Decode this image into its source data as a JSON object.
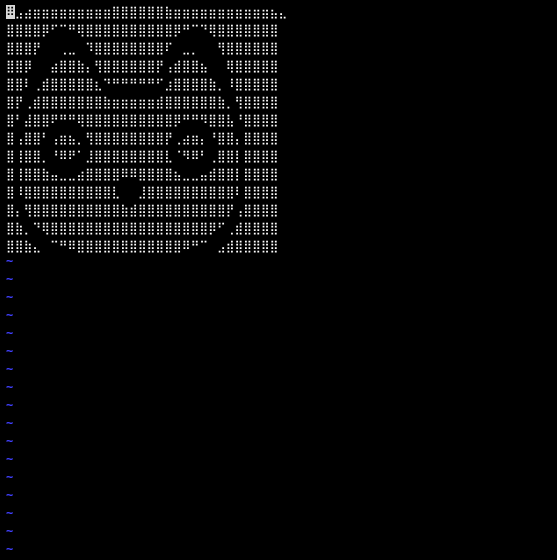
{
  "editor": {
    "cursor_char": "⠿",
    "colors": {
      "background": "#000000",
      "text": "#ffffff",
      "tilde": "#4040ff",
      "cursor": "#d8d8d8"
    },
    "lines": [
      "⣠⣴⣶⣶⣶⣶⣶⣶⣶⣶⣶⣿⣿⣿⣿⣿⣿⣷⣶⣶⣶⣶⣶⣶⣶⣶⣶⣶⣶⣦⣄",
      "⣿⣿⣿⣿⡿⠋⠉⠛⢿⣿⣿⣿⣿⣿⣿⣿⣿⣿⣿⡿⠛⠉⠙⢿⣿⣿⣿⣿⣿⣿⣿",
      "⣿⣿⣿⡟⠀⠀⢀⣀⠀⠹⣿⣿⣿⣿⣿⣿⣿⣿⠏⠀⣀⡀⠀⠀⢻⣿⣿⣿⣿⣿⣿",
      "⣿⣿⡿⠀⠀⣴⣿⣿⣷⡄⢻⣿⣿⣿⣿⣿⣿⡟⢠⣾⣿⣿⣦⠀⠀⢿⣿⣿⣿⣿⣿",
      "⣿⣿⠇⢀⣾⣿⣿⣿⣿⣿⣆⠙⠛⠛⠛⠛⠛⠋⣰⣿⣿⣿⣿⣷⡀⠸⣿⣿⣿⣿⣿",
      "⣿⡟⢀⣾⣿⣿⣿⣿⣿⣿⣿⣷⣶⣶⣶⣶⣶⣾⣿⣿⣿⣿⣿⣿⣷⡀⢻⣿⣿⣿⣿",
      "⣿⠃⣼⣿⣿⠟⠛⠛⢿⣿⣿⣿⣿⣿⣿⣿⣿⣿⣿⡿⠛⠛⠻⣿⣿⣧⠘⣿⣿⣿⣿",
      "⣿⢠⣿⣿⠃⢠⣶⣦⡀⢻⣿⣿⣿⣿⣿⣿⣿⣿⡟⢀⣴⣶⡄⠘⣿⣿⡄⣿⣿⣿⣿",
      "⣿⢸⣿⣿⡀⠘⠿⠟⠁⣸⣿⣿⣿⣿⣿⣿⣿⣿⣇⠈⠻⠿⠃⢀⣿⣿⡇⣿⣿⣿⣿",
      "⣿⢸⣿⣿⣷⣤⣀⣀⣴⣿⣿⣿⣿⠿⠿⣿⣿⣿⣿⣦⣀⣀⣤⣾⣿⣿⡇⣿⣿⣿⣿",
      "⣿⠸⣿⣿⣿⣿⣿⣿⣿⣿⣿⣿⣇⠀⠀⣸⣿⣿⣿⣿⣿⣿⣿⣿⣿⣿⠇⣿⣿⣿⣿",
      "⣿⡄⢻⣿⣿⣿⣿⣿⣿⣿⣿⣿⣿⣷⣾⣿⣿⣿⣿⣿⣿⣿⣿⣿⣿⡟⢠⣿⣿⣿⣿",
      "⣿⣷⡀⠙⢿⣿⣿⣿⣿⣿⣿⣿⣿⣿⣿⣿⣿⣿⣿⣿⣿⣿⣿⡿⠋⢀⣾⣿⣿⣿⣿",
      "⣿⣿⣷⣄⠀⠉⠛⠿⣿⣿⣿⣿⣿⣿⣿⣿⣿⣿⣿⣿⠿⠛⠉⠀⣠⣾⣿⣿⣿⣿⣿"
    ],
    "tilde_lines": [
      "~",
      "~",
      "~",
      "~",
      "~",
      "~",
      "~",
      "~",
      "~",
      "~",
      "~",
      "~",
      "~",
      "~",
      "~",
      "~",
      "~"
    ]
  }
}
